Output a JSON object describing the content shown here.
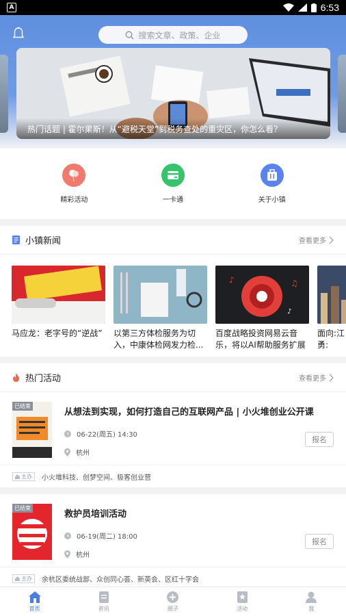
{
  "status_bar": {
    "time": "6:53",
    "left_icon": "A"
  },
  "header": {
    "search_placeholder": "搜索文章、政策、企业",
    "banner_caption": "热门话题 | 霍尔果斯！从“避税天堂”到税务查处的重灾区，你怎么看？"
  },
  "quick_links": [
    {
      "label": "精彩活动",
      "color": "#f07a6e",
      "icon": "balloon-icon"
    },
    {
      "label": "一卡通",
      "color": "#36c46b",
      "icon": "card-icon"
    },
    {
      "label": "关于小镇",
      "color": "#5a83ee",
      "icon": "briefcase-icon"
    }
  ],
  "news_section": {
    "title": "小镇新闻",
    "more": "查看更多",
    "items": [
      {
        "title": "马应龙：老字号的“逆战”"
      },
      {
        "title": "以第三方体检服务为切入，中康体检网发力检..."
      },
      {
        "title": "百度战略投资网易云音乐，将以AI帮助服务扩展"
      },
      {
        "title": "面向:江勇:"
      }
    ]
  },
  "events_section": {
    "title": "热门活动",
    "more": "查看更多",
    "items": [
      {
        "status": "已结束",
        "title": "从想法到实现，如何打造自己的互联网产品 | 小火堆创业公开课",
        "datetime": "06-22(周五)  14:30",
        "location": "杭州",
        "action": "报名",
        "host_tag": "主办",
        "hosts": "小火堆科技、创梦空间、极客创业营"
      },
      {
        "status": "已结束",
        "title": "救护员培训活动",
        "datetime": "06-19(周二)  18:00",
        "location": "杭州",
        "action": "报名",
        "host_tag": "主办",
        "hosts": "余杭区委统战部、众创同心荟、新英会、区红十字会"
      }
    ]
  },
  "tabbar": [
    {
      "label": "首页",
      "icon": "home-icon",
      "active": true
    },
    {
      "label": "资讯",
      "icon": "news-icon",
      "active": false
    },
    {
      "label": "圈子",
      "icon": "circle-plus-icon",
      "active": false
    },
    {
      "label": "活动",
      "icon": "star-bookmark-icon",
      "active": false
    },
    {
      "label": "我",
      "icon": "person-icon",
      "active": false
    }
  ],
  "colors": {
    "accent": "#4a7de0",
    "hero_top": "#5f8fdf"
  }
}
